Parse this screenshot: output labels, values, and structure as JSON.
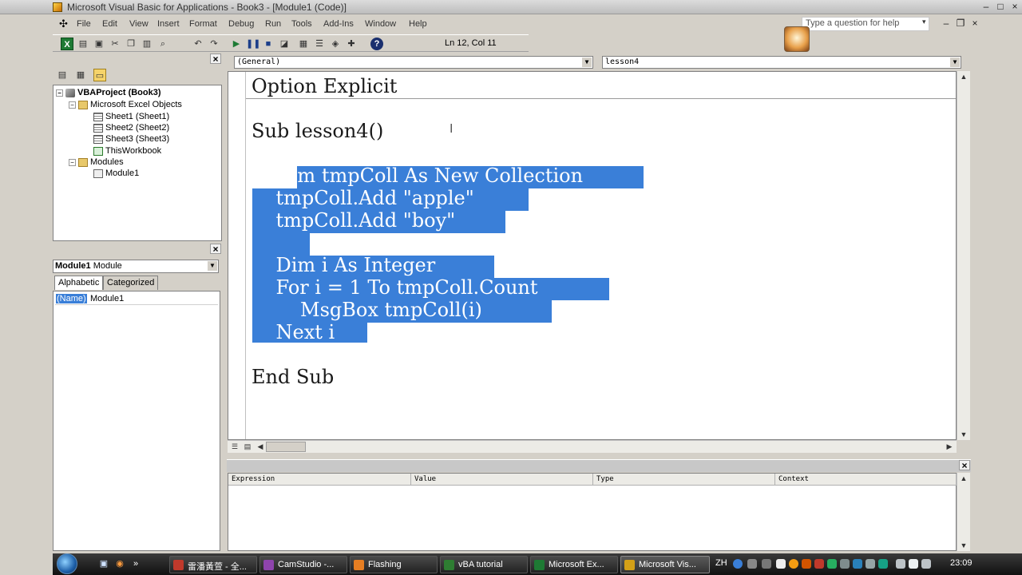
{
  "window": {
    "title": "Microsoft Visual Basic for Applications - Book3 - [Module1 (Code)]",
    "min": "–",
    "max": "□",
    "close": "×"
  },
  "menu": {
    "items": [
      "File",
      "Edit",
      "View",
      "Insert",
      "Format",
      "Debug",
      "Run",
      "Tools",
      "Add-Ins",
      "Window",
      "Help"
    ],
    "help_placeholder": "Type a question for help",
    "help_dropdown": "▾",
    "child_min": "–",
    "child_restore": "❐",
    "child_close": "×"
  },
  "toolbar": {
    "excel_glyph": "X",
    "status": "Ln 12, Col 11",
    "help_glyph": "?"
  },
  "project_explorer": {
    "close": "×",
    "nodes": [
      {
        "label": "VBAProject (Book3)",
        "toggle": "−",
        "icon": "project-icon"
      },
      {
        "label": "Microsoft Excel Objects",
        "toggle": "−",
        "icon": "folder-icon"
      },
      {
        "label": "Sheet1 (Sheet1)",
        "icon": "sheet-icon"
      },
      {
        "label": "Sheet2 (Sheet2)",
        "icon": "sheet-icon"
      },
      {
        "label": "Sheet3 (Sheet3)",
        "icon": "sheet-icon"
      },
      {
        "label": "ThisWorkbook",
        "icon": "workbook-icon"
      },
      {
        "label": "Modules",
        "toggle": "−",
        "icon": "folder-icon"
      },
      {
        "label": "Module1",
        "icon": "module-icon"
      }
    ]
  },
  "properties": {
    "close": "×",
    "object_name": "Module1",
    "object_type": "Module",
    "tabs": [
      "Alphabetic",
      "Categorized"
    ],
    "rows": [
      {
        "name": "(Name)",
        "value": "Module1"
      }
    ]
  },
  "code": {
    "object_combo": "(General)",
    "procedure_combo": "lesson4",
    "lines": [
      {
        "text": "Option Explicit",
        "selected": false
      },
      {
        "text": "Sub lesson4()",
        "selected": false
      },
      {
        "text": "    Dim tmpColl As New Collection",
        "selected": true
      },
      {
        "text": "    tmpColl.Add \"apple\"",
        "selected": true
      },
      {
        "text": "    tmpColl.Add \"boy\"",
        "selected": true
      },
      {
        "text": "",
        "selected": true
      },
      {
        "text": "    Dim i As Integer",
        "selected": true
      },
      {
        "text": "    For i = 1 To tmpColl.Count",
        "selected": true
      },
      {
        "text": "        MsgBox tmpColl(i)",
        "selected": true
      },
      {
        "text": "    Next i",
        "selected": true
      },
      {
        "text": "End Sub",
        "selected": false
      }
    ],
    "caret": "I"
  },
  "watch": {
    "close": "×",
    "columns": [
      "Expression",
      "Value",
      "Type",
      "Context"
    ]
  },
  "taskbar": {
    "buttons": [
      {
        "label": "雷潘黃萱 - 全...",
        "color": "#c0392b",
        "active": false
      },
      {
        "label": "CamStudio -...",
        "color": "#8e44ad",
        "active": false
      },
      {
        "label": "Flashing",
        "color": "#e67e22",
        "active": false
      },
      {
        "label": "vBA tutorial",
        "color": "#2e7d32",
        "active": false
      },
      {
        "label": "Microsoft Ex...",
        "color": "#1e7a34",
        "active": false
      },
      {
        "label": "Microsoft Vis...",
        "color": "#d4a017",
        "active": true
      }
    ],
    "lang": "ZH",
    "clock": "23:09"
  }
}
